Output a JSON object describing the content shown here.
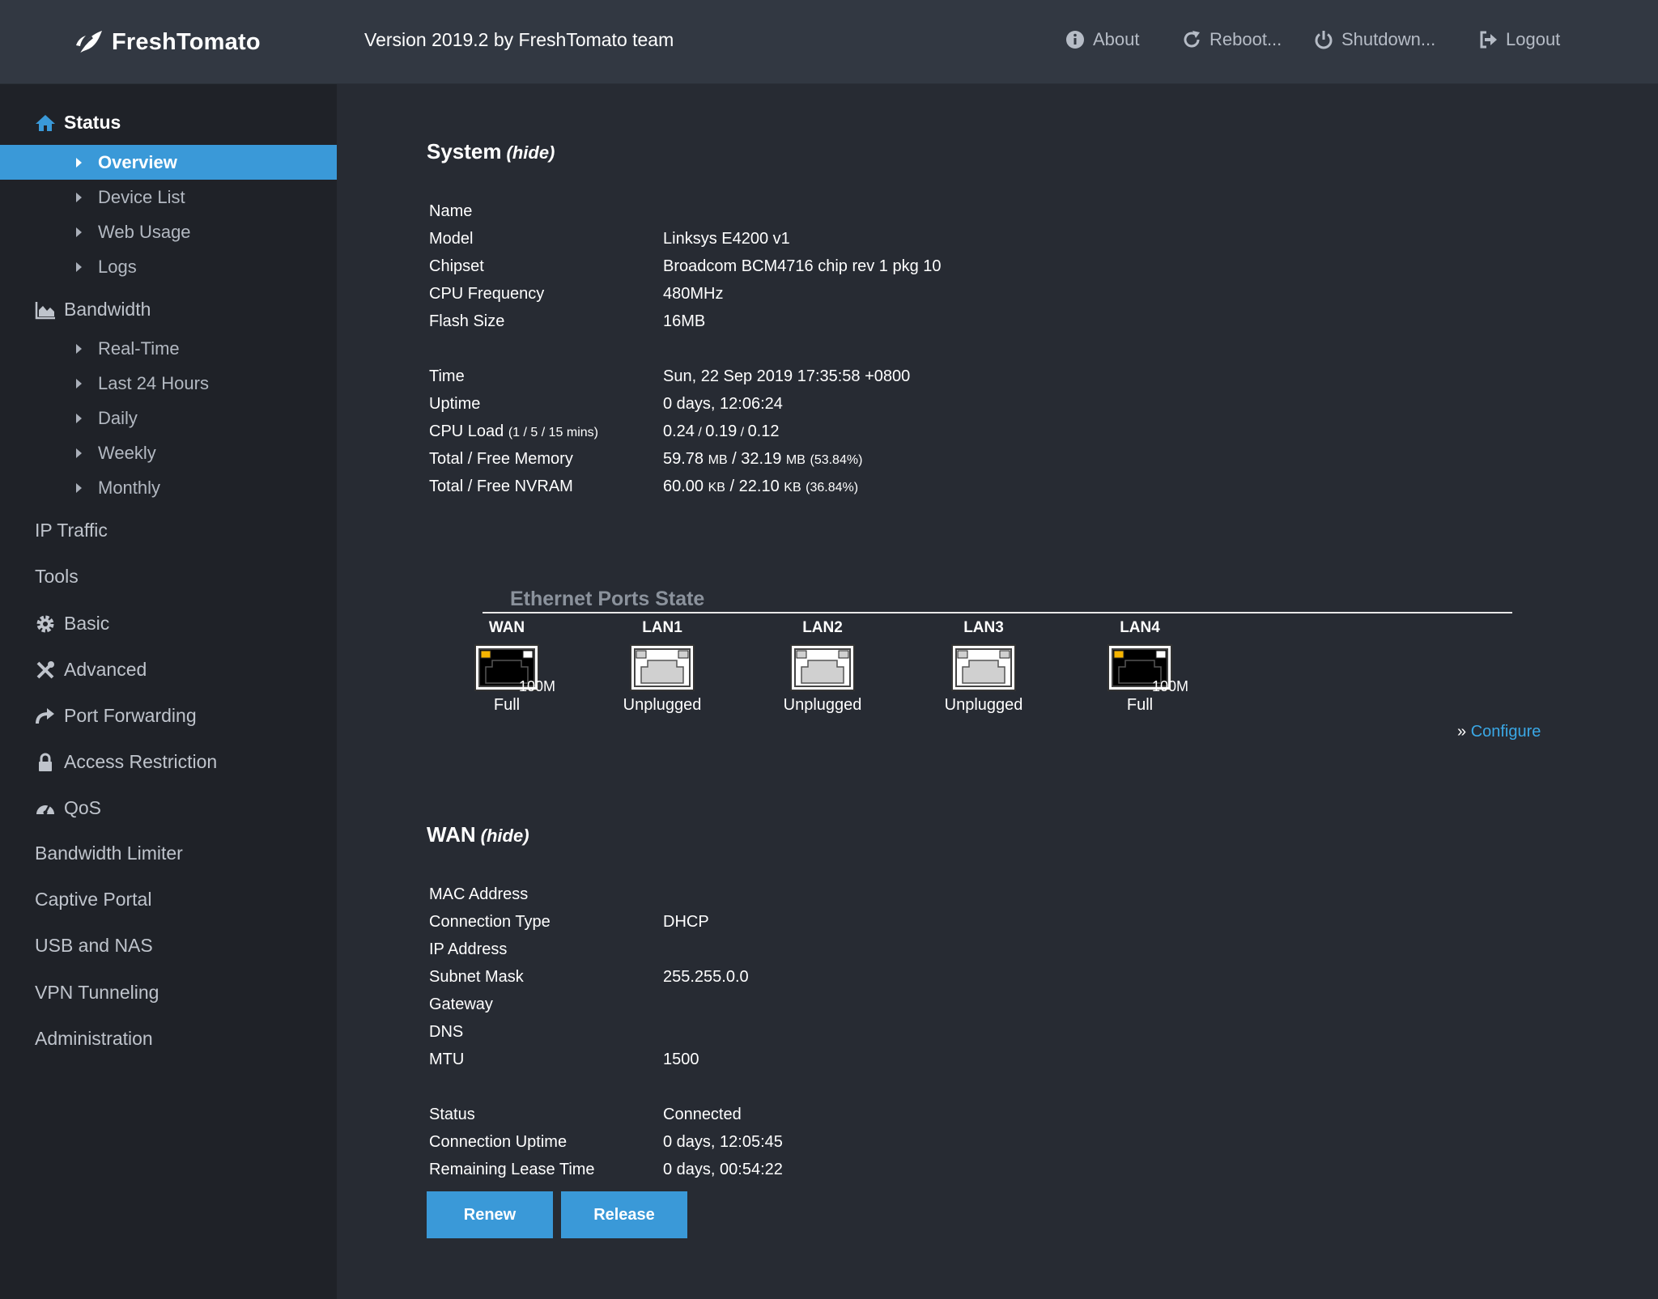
{
  "header": {
    "logo_text": "FreshTomato",
    "version": "Version 2019.2 by FreshTomato team",
    "nav": {
      "about": "About",
      "reboot": "Reboot...",
      "shutdown": "Shutdown...",
      "logout": "Logout"
    }
  },
  "sidebar": {
    "status": "Status",
    "status_items": [
      "Overview",
      "Device List",
      "Web Usage",
      "Logs"
    ],
    "bandwidth": "Bandwidth",
    "bandwidth_items": [
      "Real-Time",
      "Last 24 Hours",
      "Daily",
      "Weekly",
      "Monthly"
    ],
    "ip_traffic": "IP Traffic",
    "tools": "Tools",
    "basic": "Basic",
    "advanced": "Advanced",
    "port_forwarding": "Port Forwarding",
    "access_restriction": "Access Restriction",
    "qos": "QoS",
    "bandwidth_limiter": "Bandwidth Limiter",
    "captive_portal": "Captive Portal",
    "usb_nas": "USB and NAS",
    "vpn": "VPN Tunneling",
    "administration": "Administration"
  },
  "system": {
    "title": "System",
    "hide": "(hide)",
    "name_label": "Name",
    "model_label": "Model",
    "model": "Linksys E4200 v1",
    "chipset_label": "Chipset",
    "chipset": "Broadcom BCM4716 chip rev 1 pkg 10",
    "cpu_freq_label": "CPU Frequency",
    "cpu_freq": "480MHz",
    "flash_label": "Flash Size",
    "flash": "16MB",
    "time_label": "Time",
    "time": "Sun, 22 Sep 2019 17:35:58 +0800",
    "uptime_label": "Uptime",
    "uptime": "0 days, 12:06:24",
    "cpu_load_label": "CPU Load",
    "cpu_load_suffix": "(1 / 5 / 15 mins)",
    "cpu_load_1": "0.24",
    "cpu_load_5": "0.19",
    "cpu_load_15": "0.12",
    "mem_label": "Total / Free Memory",
    "mem_total": "59.78",
    "mem_free": "32.19",
    "mem_unit": "MB",
    "mem_pct": "(53.84%)",
    "nvram_label": "Total / Free NVRAM",
    "nvram_total": "60.00",
    "nvram_free": "22.10",
    "nvram_unit": "KB",
    "nvram_pct": "(36.84%)"
  },
  "ethernet": {
    "title": "Ethernet Ports State",
    "ports": [
      {
        "name": "WAN",
        "status": "Full",
        "speed": "100M",
        "connected": true
      },
      {
        "name": "LAN1",
        "status": "Unplugged",
        "speed": "",
        "connected": false
      },
      {
        "name": "LAN2",
        "status": "Unplugged",
        "speed": "",
        "connected": false
      },
      {
        "name": "LAN3",
        "status": "Unplugged",
        "speed": "",
        "connected": false
      },
      {
        "name": "LAN4",
        "status": "Full",
        "speed": "100M",
        "connected": true
      }
    ],
    "configure_prefix": "»",
    "configure": "Configure"
  },
  "wan": {
    "title": "WAN",
    "hide": "(hide)",
    "mac_label": "MAC Address",
    "conn_type_label": "Connection Type",
    "conn_type": "DHCP",
    "ip_label": "IP Address",
    "subnet_label": "Subnet Mask",
    "subnet": "255.255.0.0",
    "gateway_label": "Gateway",
    "dns_label": "DNS",
    "mtu_label": "MTU",
    "mtu": "1500",
    "status_label": "Status",
    "status": "Connected",
    "conn_uptime_label": "Connection Uptime",
    "conn_uptime": "0 days, 12:05:45",
    "lease_label": "Remaining Lease Time",
    "lease": "0 days, 00:54:22",
    "renew": "Renew",
    "release": "Release"
  },
  "colors": {
    "accent": "#3a99d8",
    "header_bg": "#323842",
    "sidebar_bg": "#1f2228",
    "main_bg": "#272b33",
    "link": "#3aa8e6",
    "port_led": "#f5b400"
  }
}
